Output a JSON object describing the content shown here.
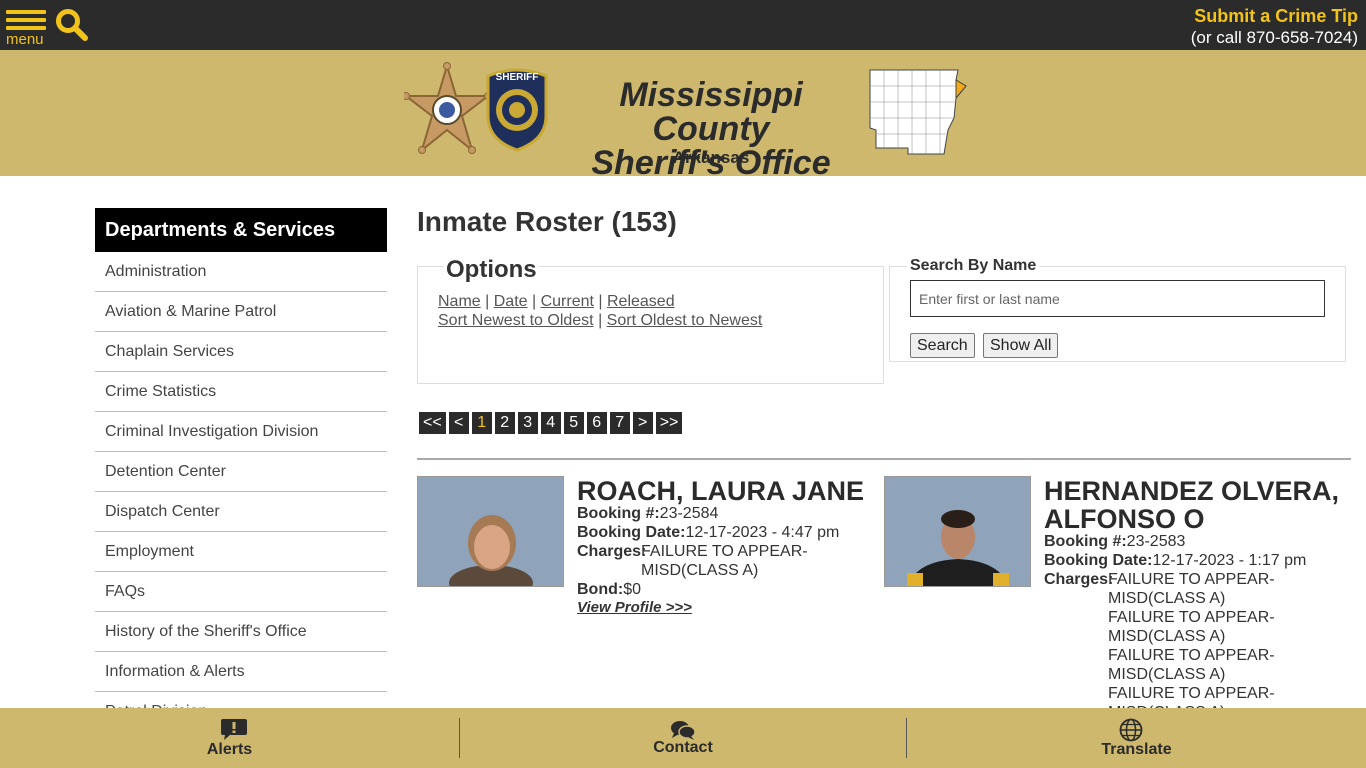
{
  "topbar": {
    "menu_label": "menu",
    "tip_title": "Submit a Crime Tip",
    "tip_phone": "(or call 870-658-7024)"
  },
  "header": {
    "title_line1": "Mississippi County",
    "title_line2": "Sheriff's Office",
    "subtitle": "Arkansas",
    "badge_text": "SHERIFF"
  },
  "sidebar": {
    "heading": "Departments & Services",
    "items": [
      "Administration",
      "Aviation & Marine Patrol",
      "Chaplain Services",
      "Crime Statistics",
      "Criminal Investigation Division",
      "Detention Center",
      "Dispatch Center",
      "Employment",
      "FAQs",
      "History of the Sheriff's Office",
      "Information & Alerts",
      "Patrol Division"
    ]
  },
  "main": {
    "title": "Inmate Roster (153)",
    "options": {
      "legend": "Options",
      "sort_name": "Name",
      "sort_date": "Date",
      "filter_current": "Current",
      "filter_released": "Released",
      "sort_newest": "Sort Newest to Oldest",
      "sort_oldest": "Sort Oldest to Newest"
    },
    "search": {
      "legend": "Search By Name",
      "placeholder": "Enter first or last name",
      "search_label": "Search",
      "show_all_label": "Show All"
    },
    "pager": [
      "<<",
      "<",
      "1",
      "2",
      "3",
      "4",
      "5",
      "6",
      "7",
      ">",
      ">>"
    ],
    "pager_active": "1"
  },
  "labels": {
    "booking_no": "Booking #:",
    "booking_date": "Booking Date:",
    "charges": "Charges:",
    "bond": "Bond:",
    "view_profile": "View Profile >>>"
  },
  "inmates": [
    {
      "name": "ROACH, LAURA JANE",
      "booking_no": "23-2584",
      "booking_date": "12-17-2023 - 4:47 pm",
      "charges": [
        "FAILURE TO APPEAR-MISD(CLASS A)"
      ],
      "bond": "$0"
    },
    {
      "name_line1": "HERNANDEZ OLVERA,",
      "name_line2": "ALFONSO O",
      "booking_no": "23-2583",
      "booking_date": "12-17-2023 - 1:17 pm",
      "charges": [
        "FAILURE TO APPEAR-MISD(CLASS A)",
        "FAILURE TO APPEAR-MISD(CLASS A)",
        "FAILURE TO APPEAR-MISD(CLASS A)",
        "FAILURE TO APPEAR-MISD(CLASS A)"
      ]
    }
  ],
  "footer": {
    "alerts": "Alerts",
    "contact": "Contact",
    "translate": "Translate"
  },
  "colors": {
    "accent": "#f2c318",
    "dark": "#2b2b2b",
    "gold_band": "#cdb86e"
  }
}
